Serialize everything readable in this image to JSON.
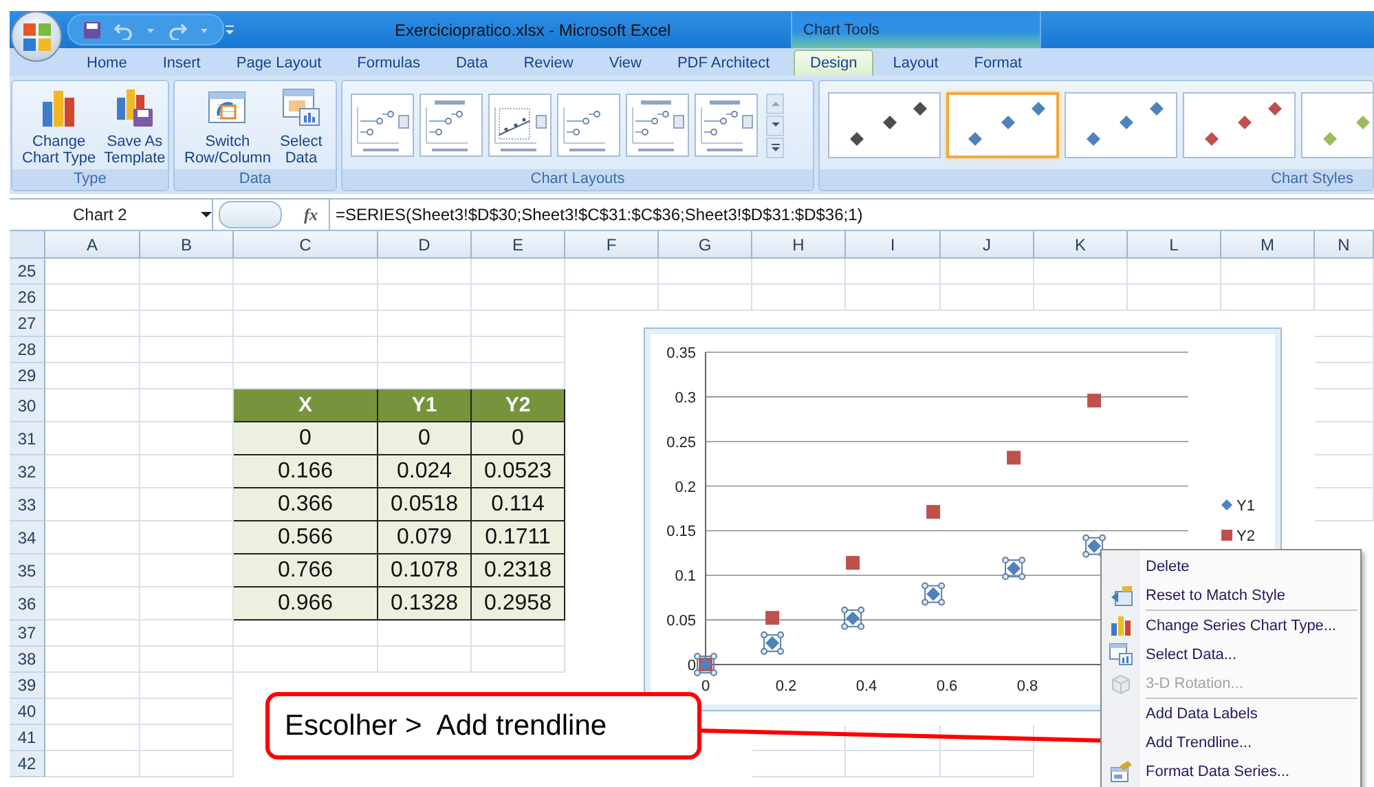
{
  "window": {
    "title": "Exerciciopratico.xlsx - Microsoft Excel",
    "contextual_group": "Chart Tools"
  },
  "tabs": [
    {
      "label": "Home",
      "selected": false
    },
    {
      "label": "Insert",
      "selected": false
    },
    {
      "label": "Page Layout",
      "selected": false
    },
    {
      "label": "Formulas",
      "selected": false
    },
    {
      "label": "Data",
      "selected": false
    },
    {
      "label": "Review",
      "selected": false
    },
    {
      "label": "View",
      "selected": false
    },
    {
      "label": "PDF Architect",
      "selected": false
    }
  ],
  "contextual_tabs": [
    {
      "label": "Design",
      "selected": true
    },
    {
      "label": "Layout",
      "selected": false
    },
    {
      "label": "Format",
      "selected": false
    }
  ],
  "ribbon": {
    "groups": [
      {
        "kind": "buttons",
        "label": "Type",
        "buttons": [
          {
            "label": "Change\nChart Type"
          },
          {
            "label": "Save As\nTemplate"
          }
        ]
      },
      {
        "kind": "buttons",
        "label": "Data",
        "buttons": [
          {
            "label": "Switch\nRow/Column"
          },
          {
            "label": "Select\nData"
          }
        ]
      },
      {
        "kind": "layouts",
        "label": "Chart Layouts",
        "items": [
          {
            "selected": false
          },
          {
            "selected": false
          },
          {
            "selected": false
          },
          {
            "selected": false
          },
          {
            "selected": false
          },
          {
            "selected": false
          }
        ]
      },
      {
        "kind": "styles",
        "label": "Chart Styles",
        "items": [
          {
            "color": "#4d4d4d",
            "selected": false
          },
          {
            "color": "#4f81bd",
            "selected": true
          },
          {
            "color": "#4f81bd",
            "selected": false
          },
          {
            "color": "#c0504d",
            "selected": false
          },
          {
            "color": "#9bbb59",
            "selected": false
          }
        ]
      }
    ]
  },
  "formula_bar": {
    "name_box": "Chart 2",
    "function_button": "fx",
    "formula": "=SERIES(Sheet3!$D$30;Sheet3!$C$31:$C$36;Sheet3!$D$31:$D$36;1)"
  },
  "sheet": {
    "columns": [
      "A",
      "B",
      "C",
      "D",
      "E",
      "F",
      "G",
      "H",
      "I",
      "J",
      "K",
      "L",
      "M",
      "N"
    ],
    "rows": [
      "25",
      "26",
      "27",
      "28",
      "29",
      "30",
      "31",
      "32",
      "33",
      "34",
      "35",
      "36",
      "37",
      "38",
      "39",
      "40",
      "41",
      "42"
    ]
  },
  "table": {
    "columns": [
      "X",
      "Y1",
      "Y2"
    ],
    "rows": [
      [
        "0",
        "0",
        "0"
      ],
      [
        "0.166",
        "0.024",
        "0.0523"
      ],
      [
        "0.366",
        "0.0518",
        "0.114"
      ],
      [
        "0.566",
        "0.079",
        "0.1711"
      ],
      [
        "0.766",
        "0.1078",
        "0.2318"
      ],
      [
        "0.966",
        "0.1328",
        "0.2958"
      ]
    ]
  },
  "chart": {
    "series_states": [
      {
        "selected": true
      },
      {
        "selected": false
      }
    ],
    "chart_data": {
      "type": "scatter",
      "x": [
        0,
        0.166,
        0.366,
        0.566,
        0.766,
        0.966
      ],
      "series": [
        {
          "name": "Y1",
          "color": "#4f81bd",
          "values": [
            0,
            0.024,
            0.0518,
            0.079,
            0.1078,
            0.1328
          ]
        },
        {
          "name": "Y2",
          "color": "#c0504d",
          "values": [
            0,
            0.0523,
            0.114,
            0.1711,
            0.2318,
            0.2958
          ]
        }
      ],
      "xlim": [
        0,
        1.2
      ],
      "ylim": [
        0,
        0.35
      ],
      "grid": true,
      "legend": "right",
      "xticks": [
        0,
        0.2,
        0.4,
        0.6,
        0.8
      ],
      "yticks": [
        0,
        0.05,
        0.1,
        0.15,
        0.2,
        0.25,
        0.3,
        0.35
      ]
    }
  },
  "context_menu": {
    "items": [
      {
        "kind": "item",
        "label": "Delete",
        "disabled": false
      },
      {
        "kind": "item",
        "label": "Reset to Match Style",
        "disabled": false
      },
      {
        "kind": "separator"
      },
      {
        "kind": "item",
        "label": "Change Series Chart Type...",
        "disabled": false
      },
      {
        "kind": "item",
        "label": "Select Data...",
        "disabled": false
      },
      {
        "kind": "item",
        "label": "3-D Rotation...",
        "disabled": true
      },
      {
        "kind": "separator"
      },
      {
        "kind": "item",
        "label": "Add Data Labels",
        "disabled": false
      },
      {
        "kind": "item",
        "label": "Add Trendline...",
        "disabled": false
      },
      {
        "kind": "item",
        "label": "Format Data Series...",
        "disabled": false
      }
    ]
  },
  "callout": {
    "text": "Escolher >  Add trendline"
  }
}
